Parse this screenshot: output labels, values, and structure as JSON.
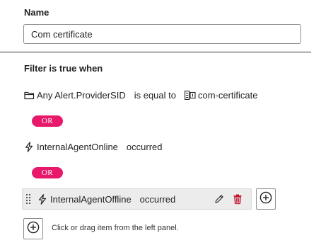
{
  "name_label": "Name",
  "name_value": "Com certificate",
  "filter_label": "Filter is true when",
  "conditions": [
    {
      "icon": "folder-icon",
      "subject": "Any Alert.ProviderSID",
      "operator": "is equal to",
      "value_icon": "value-type-icon",
      "value": "com-certificate"
    },
    {
      "icon": "lightning-icon",
      "subject": "InternalAgentOnline",
      "operator": "occurred"
    },
    {
      "icon": "lightning-icon",
      "subject": "InternalAgentOffline",
      "operator": "occurred"
    }
  ],
  "connectors": [
    "OR",
    "OR"
  ],
  "hint": "Click or drag item from the left panel.",
  "colors": {
    "or_pill": "#e8196b",
    "delete": "#c0172e",
    "selected_row_bg": "#ececec"
  }
}
